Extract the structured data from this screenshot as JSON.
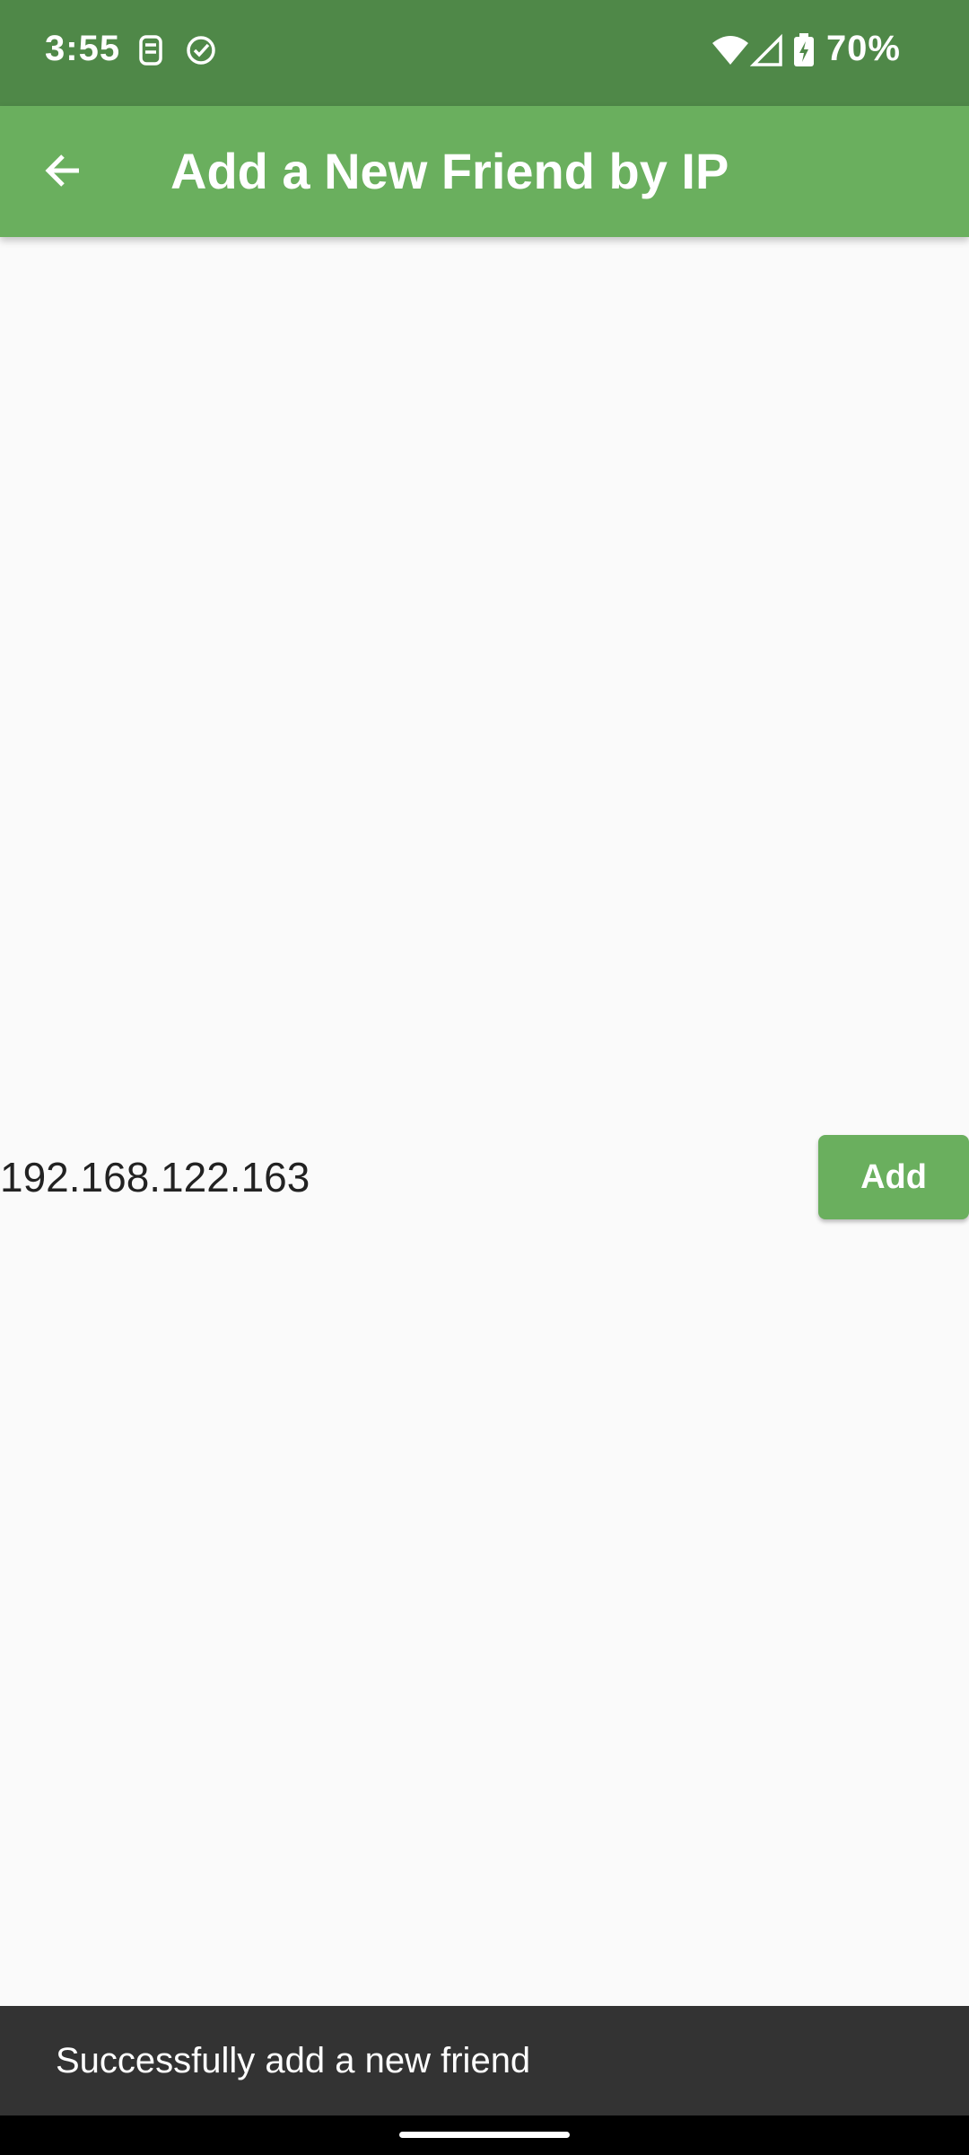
{
  "status_bar": {
    "time": "3:55",
    "battery_percent": "70%",
    "icons": [
      "sim-card-icon",
      "check-circle-icon",
      "wifi-icon",
      "signal-icon",
      "battery-charging-icon"
    ]
  },
  "app_bar": {
    "title": "Add a New Friend by IP",
    "back_icon": "arrow-back-icon"
  },
  "content": {
    "ip_value": "192.168.122.163",
    "add_button_label": "Add"
  },
  "snackbar": {
    "message": "Successfully add a new friend"
  },
  "colors": {
    "status_bar": "#4f8848",
    "app_bar": "#6aaf5e",
    "accent": "#6aaf5e",
    "background": "#fafafa",
    "snackbar": "#333333"
  }
}
